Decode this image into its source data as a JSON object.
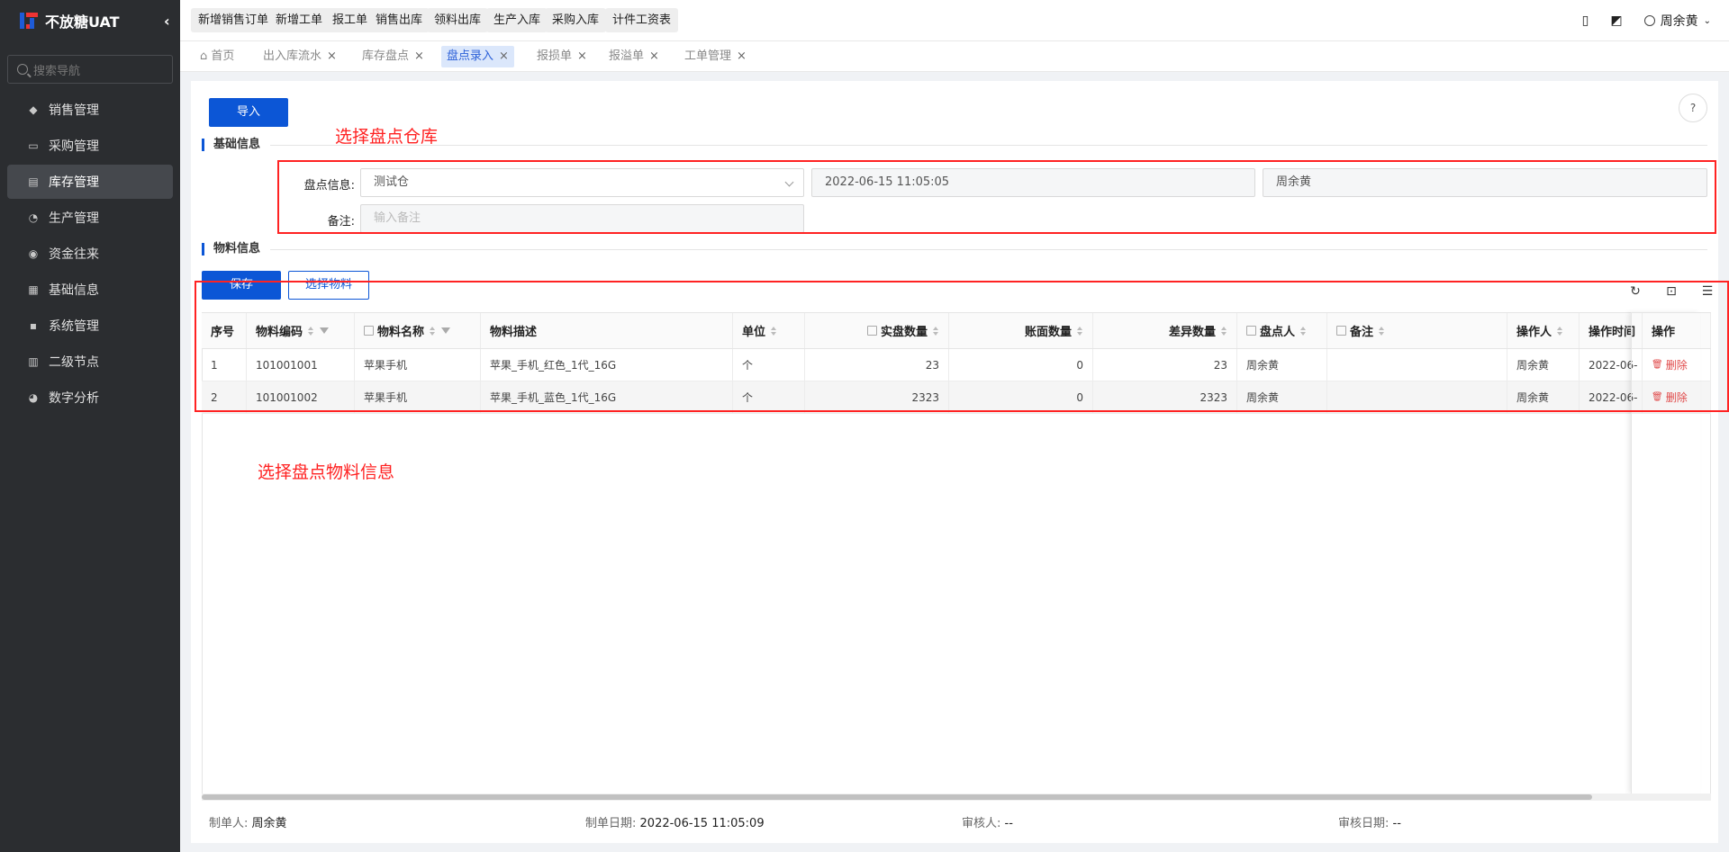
{
  "app": {
    "title": "不放糖UAT"
  },
  "sidebar": {
    "search_placeholder": "搜索导航",
    "items": [
      {
        "label": "销售管理",
        "icon": "tag-icon"
      },
      {
        "label": "采购管理",
        "icon": "cart-icon"
      },
      {
        "label": "库存管理",
        "icon": "box-icon",
        "active": true
      },
      {
        "label": "生产管理",
        "icon": "factory-icon"
      },
      {
        "label": "资金往来",
        "icon": "money-icon"
      },
      {
        "label": "基础信息",
        "icon": "info-icon"
      },
      {
        "label": "系统管理",
        "icon": "apps-icon"
      },
      {
        "label": "二级节点",
        "icon": "doc-icon"
      },
      {
        "label": "数字分析",
        "icon": "pie-icon"
      }
    ]
  },
  "topbar": {
    "quick_buttons": [
      "新增销售订单",
      "新增工单",
      "报工单",
      "销售出库",
      "领料出库",
      "生产入库",
      "采购入库",
      "计件工资表"
    ],
    "user": "周余黄"
  },
  "tabs": [
    {
      "label": "首页"
    },
    {
      "label": "出入库流水"
    },
    {
      "label": "库存盘点"
    },
    {
      "label": "盘点录入",
      "active": true
    },
    {
      "label": "报损单"
    },
    {
      "label": "报溢单"
    },
    {
      "label": "工单管理"
    }
  ],
  "main": {
    "import_label": "导入",
    "basic_section": "基础信息",
    "material_section": "物料信息",
    "annotation_warehouse": "选择盘点仓库",
    "annotation_material": "选择盘点物料信息",
    "form": {
      "count_info_label": "盘点信息:",
      "warehouse_value": "测试仓",
      "datetime_value": "2022-06-15 11:05:05",
      "person_value": "周余黄",
      "remark_label": "备注:",
      "remark_placeholder": "输入备注"
    },
    "save_label": "保存",
    "select_material_label": "选择物料"
  },
  "table": {
    "headers": [
      "序号",
      "物料编码",
      "物料名称",
      "物料描述",
      "单位",
      "实盘数量",
      "账面数量",
      "差异数量",
      "盘点人",
      "备注",
      "操作人",
      "操作时间",
      "操作"
    ],
    "rows": [
      {
        "idx": "1",
        "code": "101001001",
        "name": "苹果手机",
        "desc": "苹果_手机_红色_1代_16G",
        "unit": "个",
        "actual": "23",
        "book": "0",
        "diff": "23",
        "counter": "周余黄",
        "remark": "",
        "operator": "周余黄",
        "time": "2022-06-",
        "action": "删除"
      },
      {
        "idx": "2",
        "code": "101001002",
        "name": "苹果手机",
        "desc": "苹果_手机_蓝色_1代_16G",
        "unit": "个",
        "actual": "2323",
        "book": "0",
        "diff": "2323",
        "counter": "周余黄",
        "remark": "",
        "operator": "周余黄",
        "time": "2022-06-",
        "action": "删除"
      }
    ]
  },
  "footer": {
    "creator_label": "制单人:",
    "creator": "周余黄",
    "date_label": "制单日期:",
    "date": "2022-06-15 11:05:09",
    "auditor_label": "审核人:",
    "auditor": "--",
    "audit_date_label": "审核日期:",
    "audit_date": "--"
  }
}
